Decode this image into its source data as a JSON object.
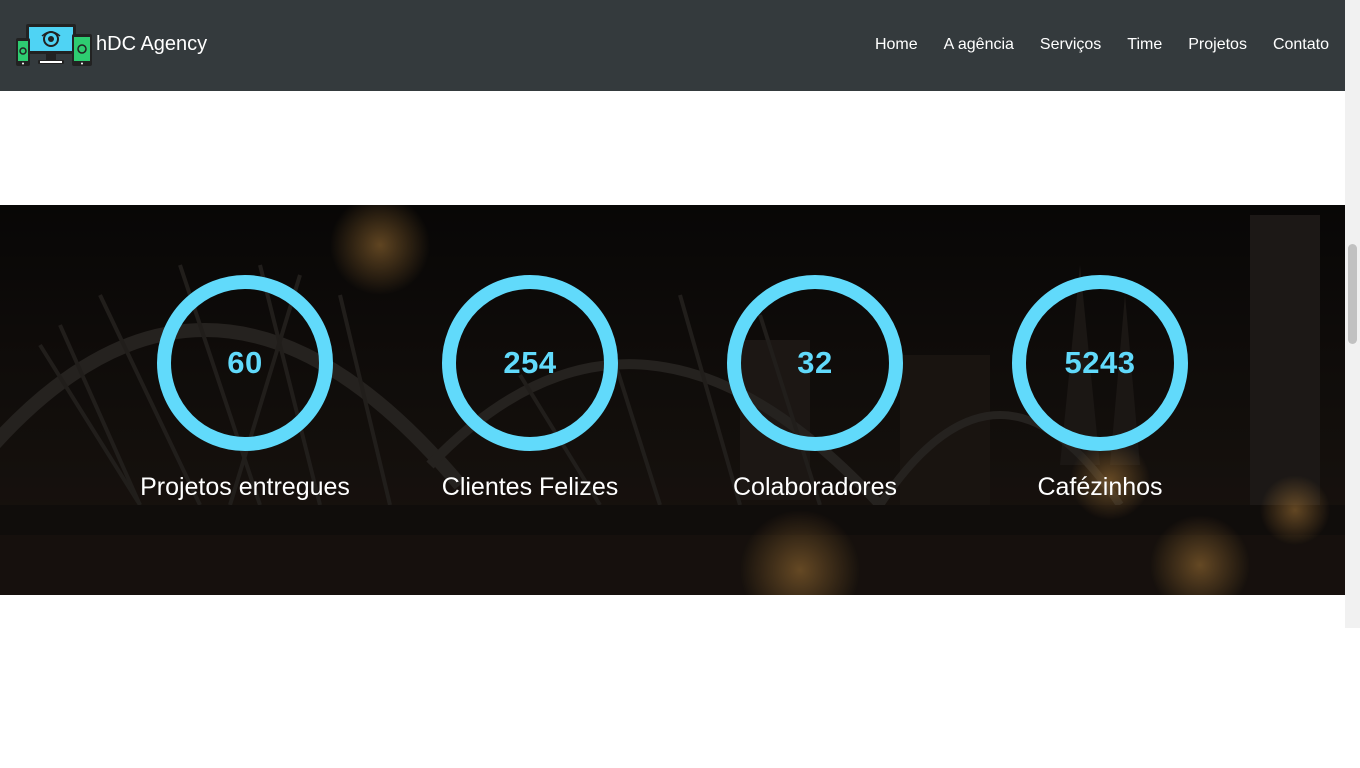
{
  "navbar": {
    "brand_name": "hDC Agency",
    "brand_logo_icon": "devices-logo-icon",
    "items": [
      {
        "label": "Home"
      },
      {
        "label": "A agência"
      },
      {
        "label": "Serviços"
      },
      {
        "label": "Time"
      },
      {
        "label": "Projetos"
      },
      {
        "label": "Contato"
      }
    ]
  },
  "counters": {
    "background": "night-bridge-city-photo",
    "ring_color": "#61dafb",
    "items": [
      {
        "value": "60",
        "label": "Projetos entregues"
      },
      {
        "value": "254",
        "label": "Clientes Felizes"
      },
      {
        "value": "32",
        "label": "Colaboradores"
      },
      {
        "value": "5243",
        "label": "Cafézinhos"
      }
    ]
  },
  "colors": {
    "navbar_bg": "#343a3d",
    "accent": "#61dafb"
  }
}
